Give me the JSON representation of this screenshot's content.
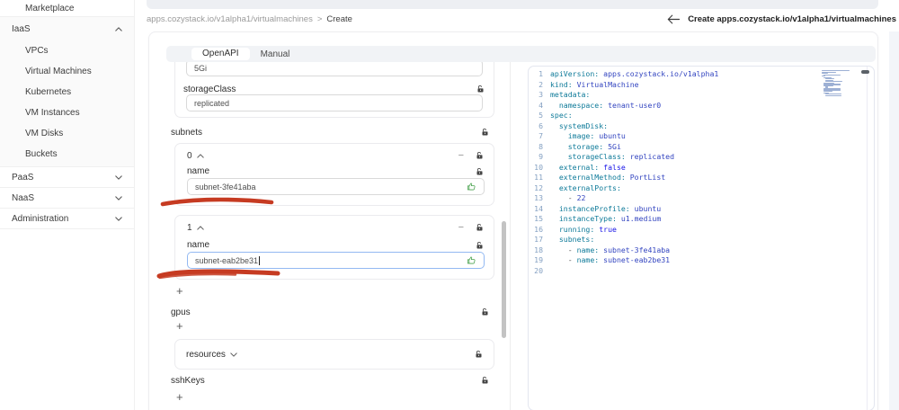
{
  "sidebar": {
    "marketplace_label": "Marketplace",
    "iaas": {
      "label": "IaaS",
      "children": [
        "VPCs",
        "Virtual Machines",
        "Kubernetes",
        "VM Instances",
        "VM Disks",
        "Buckets"
      ]
    },
    "collapsed_sections": [
      "PaaS",
      "NaaS",
      "Administration"
    ]
  },
  "header": {
    "breadcrumb_path": "apps.cozystack.io/v1alpha1/virtualmachines",
    "breadcrumb_separator": ">",
    "breadcrumb_current": "Create",
    "page_title": "Create apps.cozystack.io/v1alpha1/virtualmachines"
  },
  "tabs": {
    "openapi_label": "OpenAPI",
    "manual_label": "Manual"
  },
  "form": {
    "storage_value": "5Gi",
    "storage_class_label": "storageClass",
    "storage_class_value": "replicated",
    "subnets_label": "subnets",
    "subnet_items": [
      {
        "index": "0",
        "name_label": "name",
        "value": "subnet-3fe41aba"
      },
      {
        "index": "1",
        "name_label": "name",
        "value": "subnet-eab2be31"
      }
    ],
    "gpus_label": "gpus",
    "resources_label": "resources",
    "sshkeys_label": "sshKeys",
    "add_label": "+",
    "remove_label": "−"
  },
  "editor": {
    "lines": [
      {
        "n": "1",
        "tokens": [
          [
            "k",
            "apiVersion:"
          ],
          [
            "v",
            " apps.cozystack.io/v1alpha1"
          ]
        ]
      },
      {
        "n": "2",
        "tokens": [
          [
            "k",
            "kind:"
          ],
          [
            "v",
            " VirtualMachine"
          ]
        ]
      },
      {
        "n": "3",
        "tokens": [
          [
            "k",
            "metadata:"
          ]
        ]
      },
      {
        "n": "4",
        "tokens": [
          [
            "p",
            "  "
          ],
          [
            "k",
            "namespace:"
          ],
          [
            "v",
            " tenant-user0"
          ]
        ]
      },
      {
        "n": "5",
        "tokens": [
          [
            "k",
            "spec:"
          ]
        ]
      },
      {
        "n": "6",
        "tokens": [
          [
            "p",
            "  "
          ],
          [
            "k",
            "systemDisk:"
          ]
        ]
      },
      {
        "n": "7",
        "tokens": [
          [
            "p",
            "    "
          ],
          [
            "k",
            "image:"
          ],
          [
            "v",
            " ubuntu"
          ]
        ]
      },
      {
        "n": "8",
        "tokens": [
          [
            "p",
            "    "
          ],
          [
            "k",
            "storage:"
          ],
          [
            "v",
            " 5Gi"
          ]
        ]
      },
      {
        "n": "9",
        "tokens": [
          [
            "p",
            "    "
          ],
          [
            "k",
            "storageClass:"
          ],
          [
            "v",
            " replicated"
          ]
        ]
      },
      {
        "n": "10",
        "tokens": [
          [
            "p",
            "  "
          ],
          [
            "k",
            "external:"
          ],
          [
            "b",
            " false"
          ]
        ]
      },
      {
        "n": "11",
        "tokens": [
          [
            "p",
            "  "
          ],
          [
            "k",
            "externalMethod:"
          ],
          [
            "v",
            " PortList"
          ]
        ]
      },
      {
        "n": "12",
        "tokens": [
          [
            "p",
            "  "
          ],
          [
            "k",
            "externalPorts:"
          ]
        ]
      },
      {
        "n": "13",
        "tokens": [
          [
            "p",
            "    "
          ],
          [
            "d",
            "- "
          ],
          [
            "v",
            "22"
          ]
        ]
      },
      {
        "n": "14",
        "tokens": [
          [
            "p",
            "  "
          ],
          [
            "k",
            "instanceProfile:"
          ],
          [
            "v",
            " ubuntu"
          ]
        ]
      },
      {
        "n": "15",
        "tokens": [
          [
            "p",
            "  "
          ],
          [
            "k",
            "instanceType:"
          ],
          [
            "v",
            " u1.medium"
          ]
        ]
      },
      {
        "n": "16",
        "tokens": [
          [
            "p",
            "  "
          ],
          [
            "k",
            "running:"
          ],
          [
            "b",
            " true"
          ]
        ]
      },
      {
        "n": "17",
        "tokens": [
          [
            "p",
            "  "
          ],
          [
            "k",
            "subnets:"
          ]
        ]
      },
      {
        "n": "18",
        "tokens": [
          [
            "p",
            "    "
          ],
          [
            "d",
            "- "
          ],
          [
            "k",
            "name:"
          ],
          [
            "v",
            " subnet-3fe41aba"
          ]
        ]
      },
      {
        "n": "19",
        "tokens": [
          [
            "p",
            "    "
          ],
          [
            "d",
            "- "
          ],
          [
            "k",
            "name:"
          ],
          [
            "v",
            " subnet-eab2be31"
          ]
        ]
      },
      {
        "n": "20",
        "tokens": []
      }
    ]
  },
  "colors": {
    "focus_border": "#93b9f2",
    "annotation_red": "#c63b22",
    "like_green": "#49a24e",
    "editor_key": "#0e7a99",
    "editor_value": "#3345c0",
    "editor_bool": "#1a16e8"
  }
}
